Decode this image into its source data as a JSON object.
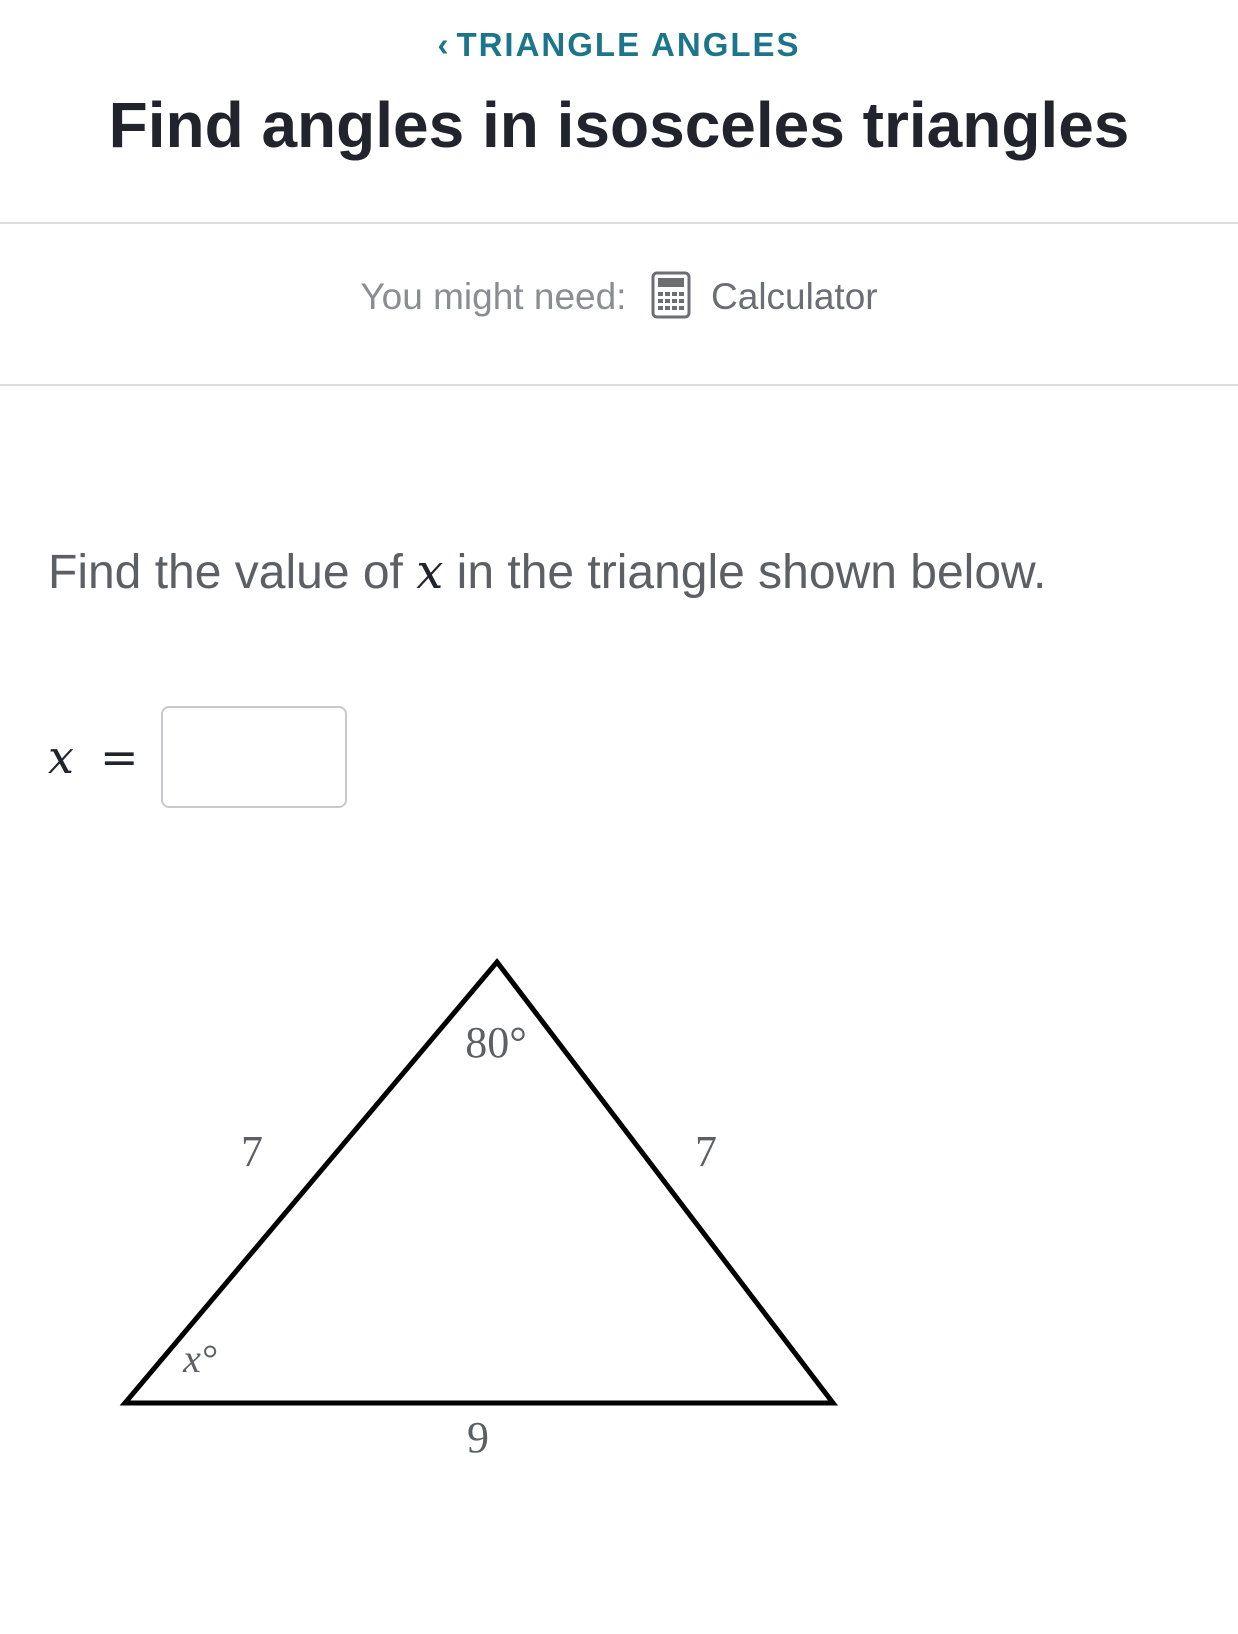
{
  "header": {
    "breadcrumb_icon": "chevron-left-icon",
    "breadcrumb_label": "TRIANGLE ANGLES",
    "title": "Find angles in isosceles triangles"
  },
  "tools": {
    "prefix": "You might need:",
    "icon": "calculator-icon",
    "tool_label": "Calculator"
  },
  "colors": {
    "accent": "#1c758a",
    "title": "#21242c",
    "muted": "#8a8d92",
    "divider": "#dcdcdc"
  },
  "question": {
    "before": "Find the value of",
    "variable": "x",
    "after": "in the triangle shown below."
  },
  "answer": {
    "variable": "x",
    "equals": "=",
    "value": "",
    "placeholder": ""
  },
  "figure": {
    "apex_angle": "80°",
    "base_angle": "x°",
    "left_side": "7",
    "right_side": "7",
    "base_side": "9"
  }
}
